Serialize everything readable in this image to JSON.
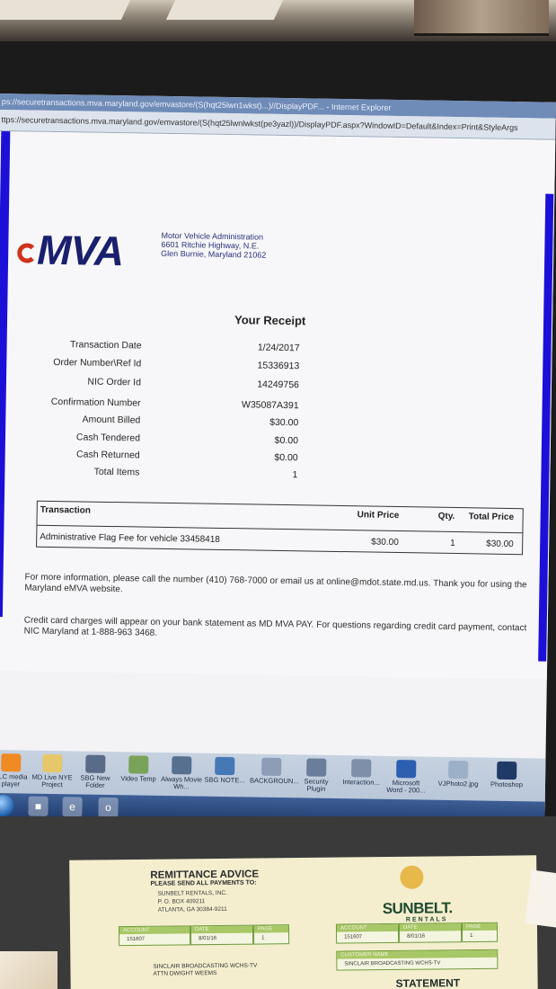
{
  "browser": {
    "title_text": "ps://securetransactions.mva.maryland.gov/emvastore/(S(hqt25lwn1wkst)...)//DisplayPDF... - Internet Explorer",
    "url_text": "ttps://securetransactions.mva.maryland.gov/emvastore/(S(hqt25lwnlwkst(pe3yazl))/DisplayPDF.aspx?WindowID=Default&Index=Print&StyleArgs"
  },
  "header": {
    "logo_text": "MVA",
    "address_lines": [
      "Motor Vehicle Administration",
      "6601 Ritchie Highway, N.E.",
      "Glen Burnie, Maryland 21062"
    ]
  },
  "receipt": {
    "title": "Your Receipt",
    "rows": [
      {
        "label": "Transaction Date",
        "value": "1/24/2017"
      },
      {
        "label": "Order Number\\Ref Id",
        "value": "15336913"
      },
      {
        "label": "NIC Order Id",
        "value": "14249756"
      },
      {
        "label": "Confirmation Number",
        "value": "W35087A391"
      },
      {
        "label": "Amount Billed",
        "value": "$30.00"
      },
      {
        "label": "Cash Tendered",
        "value": "$0.00"
      },
      {
        "label": "Cash Returned",
        "value": "$0.00"
      },
      {
        "label": "Total Items",
        "value": "1"
      }
    ]
  },
  "transaction_table": {
    "headers": {
      "transaction": "Transaction",
      "unit_price": "Unit Price",
      "qty": "Qty.",
      "total_price": "Total Price"
    },
    "row": {
      "description": "Administrative Flag Fee for vehicle 33458418",
      "unit_price": "$30.00",
      "qty": "1",
      "total_price": "$30.00"
    }
  },
  "notes": {
    "info": "For more information, please call the number (410) 768-7000 or email us at online@mdot.state.md.us. Thank you for using the Maryland eMVA website.",
    "credit": "Credit card charges will appear on your bank statement as MD MVA PAY. For questions regarding credit card payment, contact NIC Maryland at 1-888-963 3468."
  },
  "desktop": {
    "icons": [
      {
        "label": "VLC media player",
        "icon": "vlc-icon"
      },
      {
        "label": "MD Live NYE Project",
        "icon": "folder-icon"
      },
      {
        "label": "SBG New Folder",
        "icon": "folder-icon"
      },
      {
        "label": "Video Temp",
        "icon": "folder-icon"
      },
      {
        "label": "Always Movie Wh...",
        "icon": "app-icon"
      },
      {
        "label": "SBG NOTE...",
        "icon": "app-icon"
      },
      {
        "label": "BACKGROUN...",
        "icon": "app-icon"
      },
      {
        "label": "Security Plugin",
        "icon": "app-icon"
      },
      {
        "label": "Interaction...",
        "icon": "app-icon"
      },
      {
        "label": "Microsoft Word - 200...",
        "icon": "word-icon"
      },
      {
        "label": "VJPhoto2.jpg",
        "icon": "image-icon"
      },
      {
        "label": "Photoshop",
        "icon": "photoshop-icon"
      }
    ]
  },
  "paper": {
    "title": "REMITTANCE ADVICE",
    "subtitle": "PLEASE SEND ALL PAYMENTS TO:",
    "address_lines": [
      "SUNBELT RENTALS, INC.",
      "P. O. BOX 409211",
      "ATLANTA, GA 30384-9211"
    ],
    "brand": "SUNBELT.",
    "brand_sub": "RENTALS",
    "left_boxes": [
      {
        "header": "ACCOUNT",
        "value": "151607"
      },
      {
        "header": "DATE",
        "value": "8/01/16"
      },
      {
        "header": "PAGE",
        "value": "1"
      }
    ],
    "right_boxes": [
      {
        "header": "ACCOUNT",
        "value": "151607"
      },
      {
        "header": "DATE",
        "value": "8/01/16"
      },
      {
        "header": "PAGE",
        "value": "1"
      }
    ],
    "customer_lines": [
      "SINCLAIR BROADCASTING WCHS-TV",
      "ATTN DWIGHT WEEMS"
    ],
    "customer_name_header": "CUSTOMER NAME",
    "customer_name_value": "SINCLAIR BROADCASTING WCHS-TV",
    "statement": "STATEMENT"
  }
}
